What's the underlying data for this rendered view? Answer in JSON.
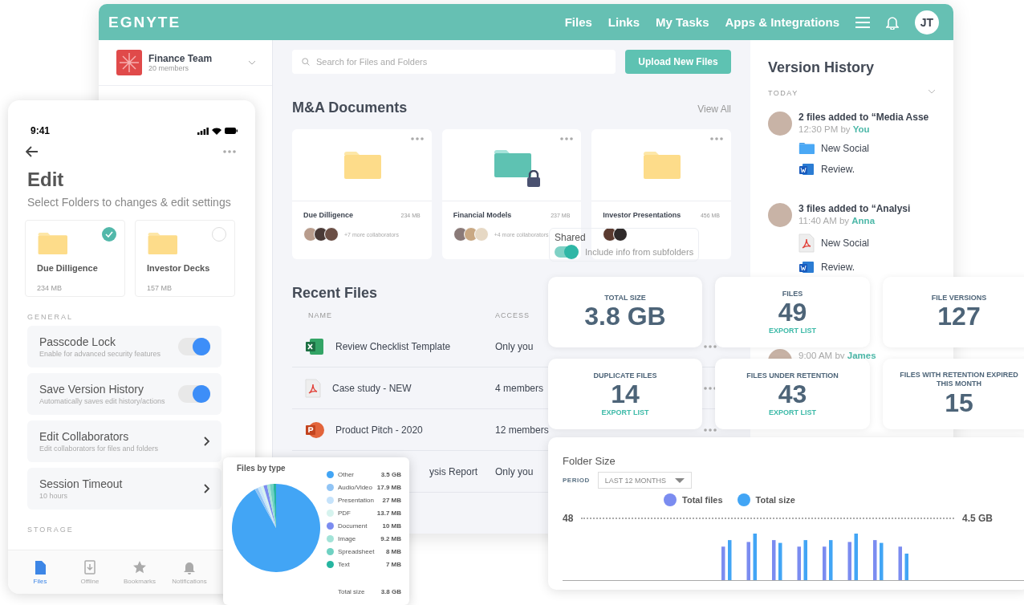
{
  "web_app": {
    "header": {
      "logo": "EGNYTE",
      "nav": [
        {
          "label": "Files"
        },
        {
          "label": "Links"
        },
        {
          "label": "My Tasks"
        },
        {
          "label": "Apps & Integrations"
        }
      ],
      "avatar": "JT"
    },
    "sidebar": {
      "team": "Finance Team",
      "members": "20 members"
    },
    "search": {
      "placeholder": "Search for Files and Folders"
    },
    "upload_button": "Upload New Files",
    "section_title": "M&A Documents",
    "view_all": "View All",
    "folders": [
      {
        "name": "Due Dilligence",
        "size": "234 MB",
        "collaborators": "+7 more collaborators",
        "kind": "plain",
        "avatars": [
          {
            "color": "#b89c8c"
          },
          {
            "color": "#4a3a36"
          },
          {
            "color": "#6b4f45"
          }
        ]
      },
      {
        "name": "Financial Models",
        "size": "237 MB",
        "collaborators": "+4 more collaborators",
        "kind": "locked",
        "avatars": [
          {
            "color": "#8a7a78"
          },
          {
            "color": "#c9a883"
          },
          {
            "color": "#e6d8c4"
          }
        ]
      },
      {
        "name": "Investor Presentations",
        "size": "456 MB",
        "kind": "plain",
        "avatars": [
          {
            "color": "#5b3b30"
          },
          {
            "color": "#2f2a2a"
          }
        ]
      }
    ],
    "recent_title": "Recent Files",
    "recent_columns": [
      "NAME",
      "ACCESS"
    ],
    "recent_rows": [
      {
        "name": "Review Checklist Template",
        "access": "Only you",
        "kind": "excel"
      },
      {
        "name": "Case study - NEW",
        "access": "4 members",
        "kind": "pdf"
      },
      {
        "name": "Product Pitch - 2020",
        "access": "12 members",
        "kind": "powerpoint"
      },
      {
        "name": "ysis Report",
        "access": "Only you",
        "kind": "clipped"
      }
    ],
    "version_history": {
      "title": "Version History",
      "group": "TODAY",
      "entries": [
        {
          "title": "2 files added to “Media Asse",
          "time": "12:30 PM by",
          "user": "You",
          "files": [
            {
              "name": "New Social",
              "kind": "folder"
            },
            {
              "name": "Review.",
              "kind": "word"
            }
          ]
        },
        {
          "title": "3 files added to “Analysi",
          "time": "11:40 AM by",
          "user": "Anna",
          "files": [
            {
              "name": "New Social",
              "kind": "pdf"
            },
            {
              "name": "Review.",
              "kind": "word"
            }
          ]
        },
        {
          "time": "9:00 AM by",
          "user": "James"
        }
      ]
    }
  },
  "shared_popup": {
    "label": "Shared",
    "toggle_label": "Include info from subfolders",
    "on": true
  },
  "phone": {
    "time": "9:41",
    "title": "Edit",
    "subtitle": "Select Folders to changes & edit settings",
    "folders": [
      {
        "name": "Due Dilligence",
        "size": "234 MB",
        "selected": true
      },
      {
        "name": "Investor Decks",
        "size": "157 MB",
        "selected": false
      }
    ],
    "general_label": "GENERAL",
    "settings": [
      {
        "title": "Passcode Lock",
        "subtitle": "Enable for advanced security features",
        "kind": "toggle",
        "on": true
      },
      {
        "title": "Save Version History",
        "subtitle": "Automatically saves edit history/actions",
        "kind": "toggle",
        "on": true
      },
      {
        "title": "Edit Collaborators",
        "subtitle": "Edit collaborators for files and folders",
        "kind": "link"
      },
      {
        "title": "Session Timeout",
        "subtitle": "10 hours",
        "kind": "link"
      }
    ],
    "storage_label": "STORAGE",
    "tabs": [
      {
        "label": "Files",
        "selected": true
      },
      {
        "label": "Offline",
        "selected": false
      },
      {
        "label": "Bookmarks",
        "selected": false
      },
      {
        "label": "Notifications",
        "selected": false
      }
    ]
  },
  "files_by_type": {
    "legend": [
      {
        "value": "3.5 GB",
        "color": "#42a5f5"
      },
      {
        "value": "17.9 MB",
        "color": "#90c4f5"
      },
      {
        "value": "27 MB",
        "color": "#c6e3fb"
      },
      {
        "value": "13.7 MB",
        "color": "#d6f3ee"
      },
      {
        "value": "10 MB",
        "color": "#7b8cf0"
      },
      {
        "value": "9.2 MB",
        "color": "#a3e3d8"
      },
      {
        "value": "8 MB",
        "color": "#6fd1c2"
      },
      {
        "value": "7 MB",
        "color": "#26b5a0"
      }
    ],
    "total_label": "Total size",
    "total_value": "3.8 GB",
    "chart_data": {
      "type": "pie",
      "title": "Files by type",
      "categories": [
        "Other",
        "Audio/Video",
        "Presentation",
        "PDF",
        "Document",
        "Image",
        "Spreadsheet",
        "Text"
      ],
      "values": [
        92,
        1.2,
        1.2,
        1,
        1.3,
        1,
        1.3,
        1
      ]
    }
  },
  "stats": [
    {
      "label": "TOTAL SIZE",
      "value": "3.8 GB"
    },
    {
      "label": "FILES",
      "value": "49",
      "action": "EXPORT LIST"
    },
    {
      "label": "FILE VERSIONS",
      "value": "127"
    },
    {
      "label": "DUPLICATE FILES",
      "value": "14",
      "action": "EXPORT LIST"
    },
    {
      "label": "FILES UNDER RETENTION",
      "value": "43",
      "action": "EXPORT LIST"
    },
    {
      "label": "FILES WITH RETENTION EXPIRED THIS MONTH",
      "value": "15"
    }
  ],
  "folder_size": {
    "title": "Folder Size",
    "period_label": "PERIOD",
    "period": "LAST 12 MONTHS",
    "legend": [
      {
        "label": "Total files",
        "color": "#7b8cf0"
      },
      {
        "label": "Total size",
        "color": "#42a5f5"
      }
    ],
    "left_label": "48",
    "right_label": "4.5 GB"
  }
}
